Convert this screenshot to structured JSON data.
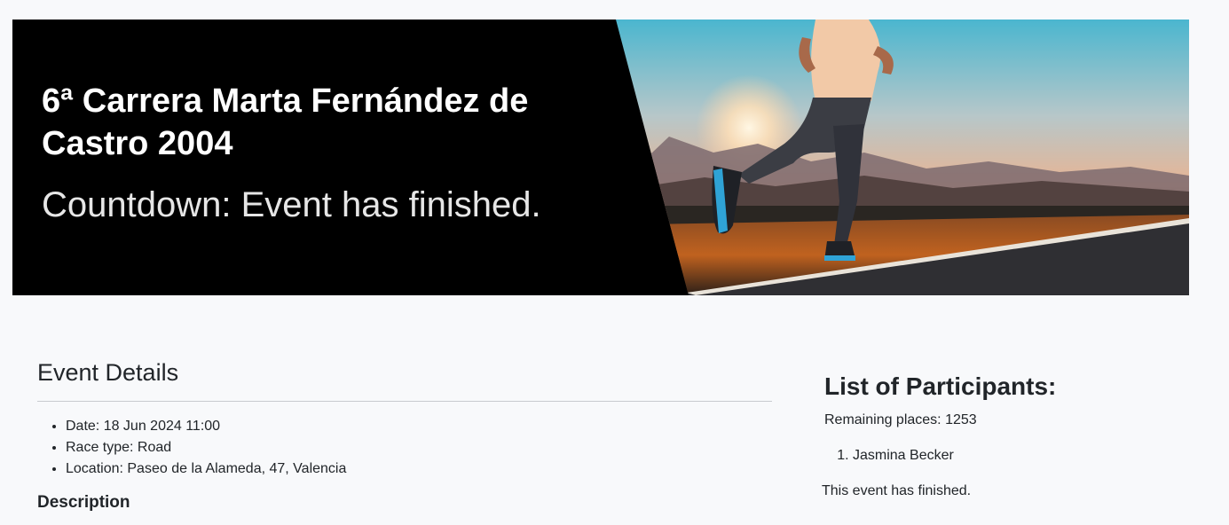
{
  "hero": {
    "title": "6ª Carrera Marta Fernández de Castro 2004",
    "countdown": "Countdown: Event has finished.",
    "image_alt": "runner-on-road-at-sunset"
  },
  "event_details": {
    "heading": "Event Details",
    "items": [
      "Date: 18 Jun 2024 11:00",
      "Race type: Road",
      "Location: Paseo de la Alameda, 47, Valencia"
    ],
    "description_heading": "Description"
  },
  "participants": {
    "heading": "List of Participants:",
    "remaining": "Remaining places: 1253",
    "list": [
      "Jasmina Becker"
    ],
    "status_note": "This event has finished."
  },
  "colors": {
    "page_background": "#f8f9fb",
    "hero_background": "#000000",
    "text": "#212529",
    "divider": "#c8cbcf"
  }
}
